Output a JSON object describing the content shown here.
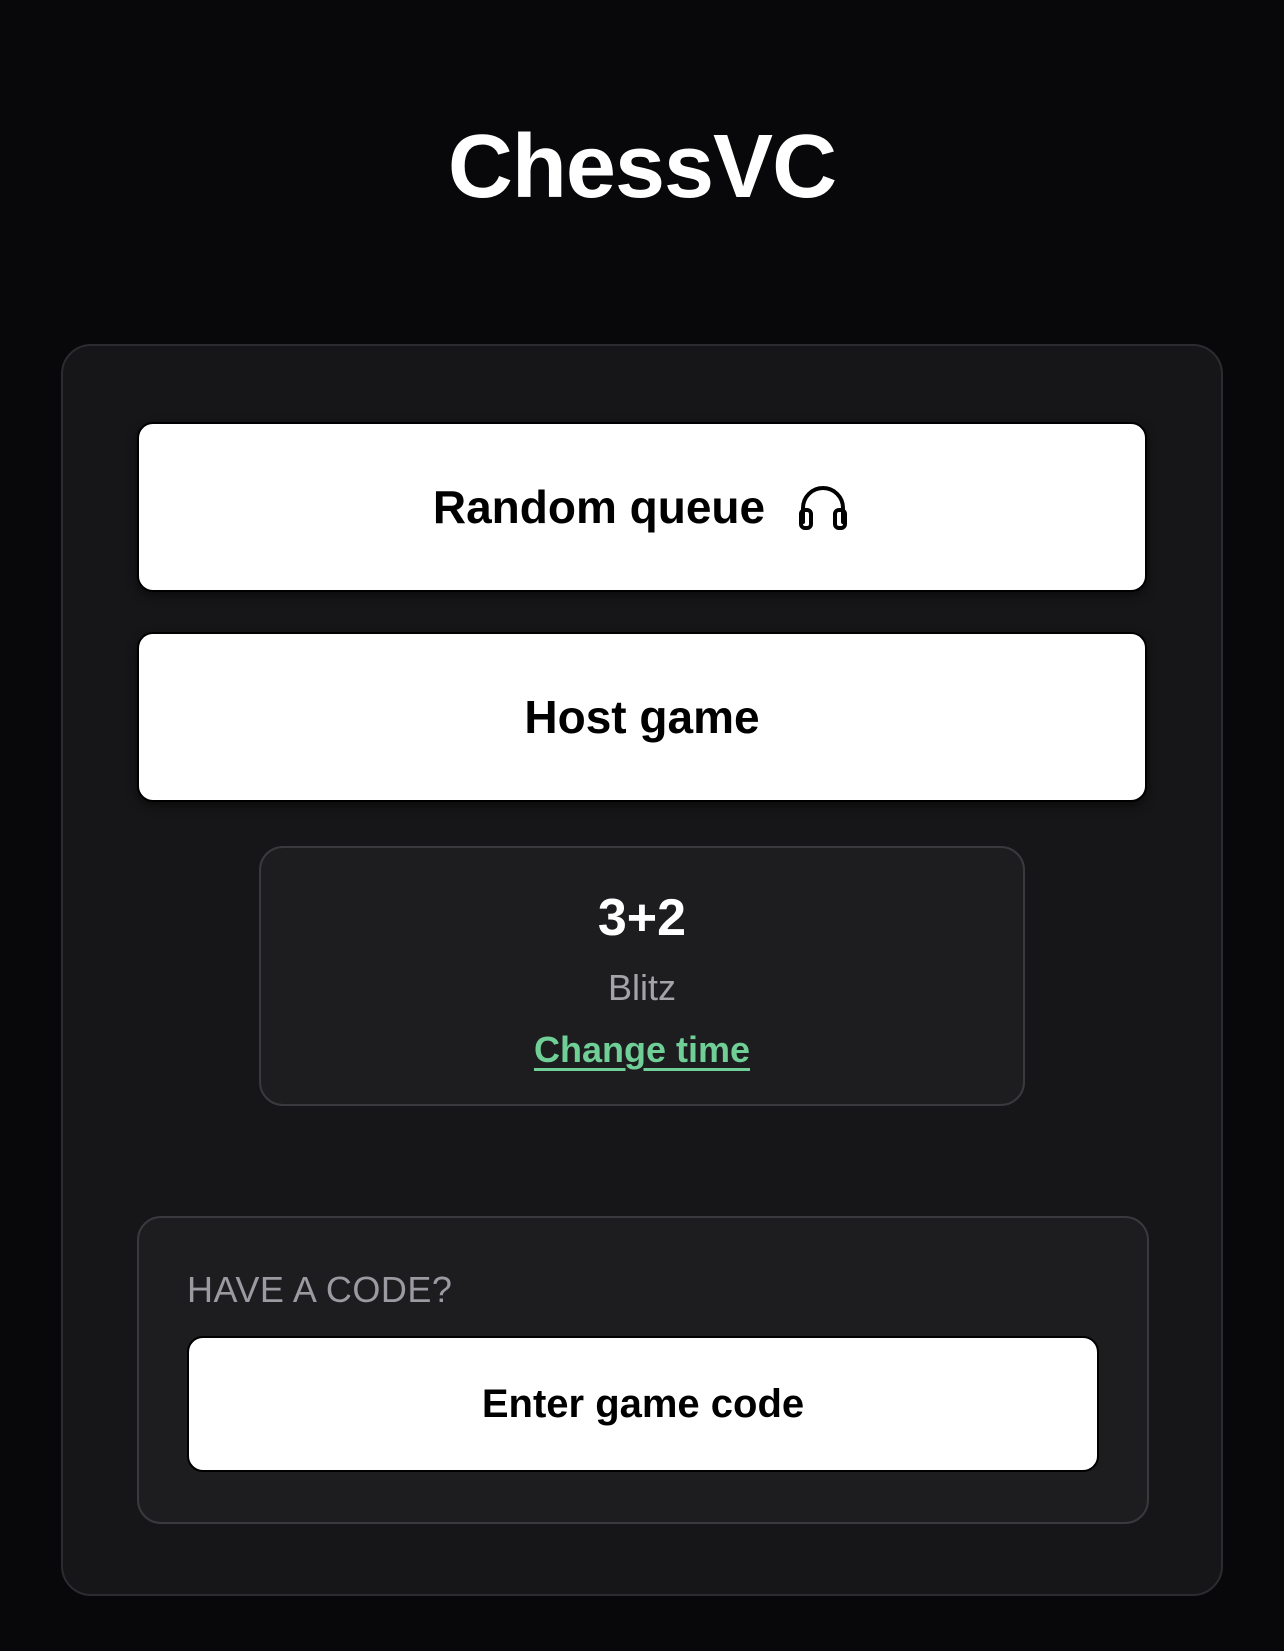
{
  "app": {
    "title": "ChessVC"
  },
  "actions": {
    "random_queue_label": "Random queue",
    "random_queue_icon": "headphones-icon",
    "host_game_label": "Host game"
  },
  "time_control": {
    "value": "3+2",
    "category": "Blitz",
    "change_label": "Change time"
  },
  "join": {
    "label": "HAVE A CODE?",
    "button_label": "Enter game code"
  },
  "colors": {
    "background": "#08080a",
    "card": "#161618",
    "accent": "#6fcf97",
    "button": "#ffffff"
  }
}
